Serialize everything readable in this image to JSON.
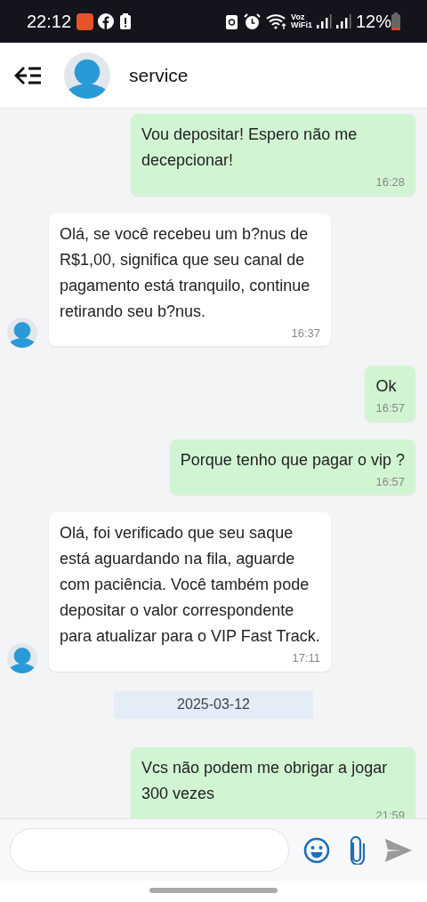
{
  "status_bar": {
    "time": "22:12",
    "network_top": "Voz",
    "network_bottom": "WiFi1",
    "battery": "12%"
  },
  "header": {
    "title": "service"
  },
  "messages": [
    {
      "kind": "sent",
      "text": "Vou depositar! Espero não me decepcionar!",
      "time": "16:28"
    },
    {
      "kind": "received",
      "text": "Olá, se você recebeu um b?nus de R$1,00, significa que seu canal de pagamento está tranquilo, continue retirando seu b?nus.",
      "time": "16:37"
    },
    {
      "kind": "sent",
      "text": "Ok",
      "time": "16:57"
    },
    {
      "kind": "sent",
      "text": "Porque tenho que pagar o vip ?",
      "time": "16:57"
    },
    {
      "kind": "received",
      "text": "Olá, foi verificado que seu saque está aguardando na fila, aguarde com paciência. Você também pode depositar o valor correspondente para atualizar para o VIP Fast Track.",
      "time": "17:11"
    },
    {
      "kind": "date",
      "text": "2025-03-12"
    },
    {
      "kind": "sent",
      "text": "Vcs não podem me obrigar a jogar 300 vezes",
      "time": "21:59"
    }
  ]
}
